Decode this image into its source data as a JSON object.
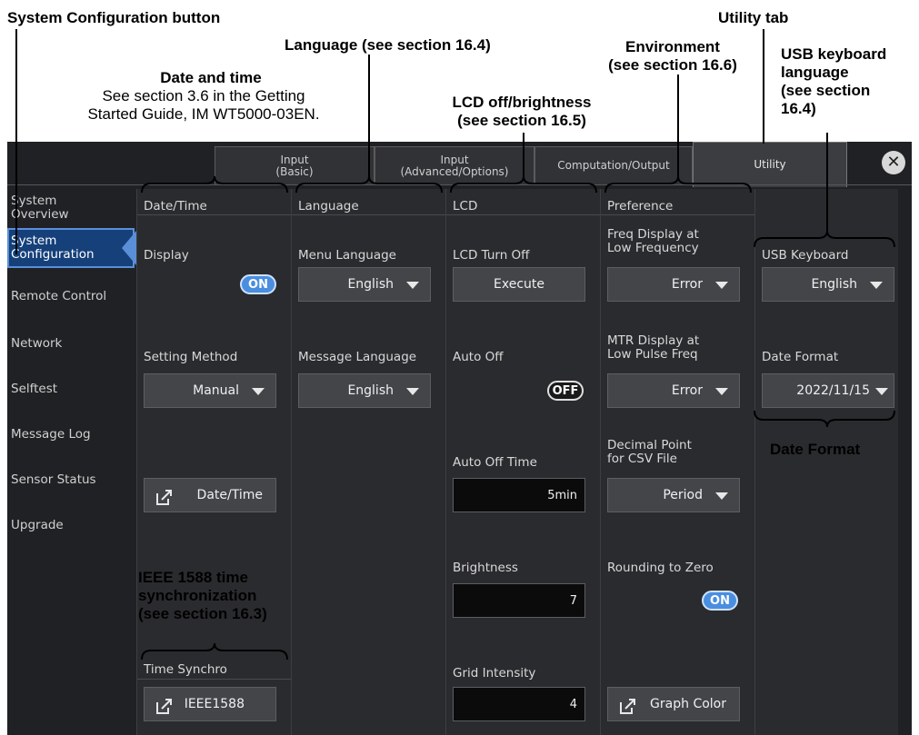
{
  "callouts": {
    "system_configuration_button": "System Configuration button",
    "utility_tab": "Utility tab",
    "language": "Language (see section 16.4)",
    "environment": [
      "Environment",
      "(see section 16.6)"
    ],
    "usb_keyboard_language": [
      "USB keyboard",
      "language",
      "(see section",
      "16.4)"
    ],
    "date_and_time_title": "Date and time",
    "date_and_time_note": [
      "See section 3.6 in the Getting",
      "Started Guide, IM WT5000-03EN."
    ],
    "lcd": [
      "LCD off/brightness",
      "(see section 16.5)"
    ],
    "date_format": "Date Format",
    "ieee1588": [
      "IEEE 1588 time",
      "synchronization",
      "(see section 16.3)"
    ]
  },
  "tabs": [
    {
      "line1": "Input",
      "line2": "(Basic)"
    },
    {
      "line1": "Input",
      "line2": "(Advanced/Options)"
    },
    {
      "line1": "Computation/Output",
      "line2": ""
    },
    {
      "line1": "Utility",
      "line2": ""
    }
  ],
  "sidebar": [
    {
      "line1": "System",
      "line2": "Overview"
    },
    {
      "line1": "System",
      "line2": "Configuration"
    },
    {
      "line1": "Remote Control",
      "line2": ""
    },
    {
      "line1": "Network",
      "line2": ""
    },
    {
      "line1": "Selftest",
      "line2": ""
    },
    {
      "line1": "Message Log",
      "line2": ""
    },
    {
      "line1": "Sensor Status",
      "line2": ""
    },
    {
      "line1": "Upgrade",
      "line2": ""
    }
  ],
  "datetime": {
    "header": "Date/Time",
    "display_label": "Display",
    "display_state": "ON",
    "setting_method_label": "Setting Method",
    "setting_method_value": "Manual",
    "datetime_button": "Date/Time",
    "time_synchro_header": "Time Synchro",
    "ieee_button": "IEEE1588"
  },
  "language": {
    "header": "Language",
    "menu_label": "Menu Language",
    "menu_value": "English",
    "message_label": "Message Language",
    "message_value": "English"
  },
  "lcd": {
    "header": "LCD",
    "turn_off_label": "LCD Turn Off",
    "execute_button": "Execute",
    "auto_off_label": "Auto Off",
    "auto_off_state": "OFF",
    "auto_off_time_label": "Auto Off Time",
    "auto_off_time_value": "5min",
    "brightness_label": "Brightness",
    "brightness_value": "7",
    "grid_label": "Grid Intensity",
    "grid_value": "4"
  },
  "preference": {
    "header": "Preference",
    "freq_label": [
      "Freq Display at",
      "Low Frequency"
    ],
    "freq_value": "Error",
    "mtr_label": [
      "MTR Display at",
      "Low Pulse Freq"
    ],
    "mtr_value": "Error",
    "decimal_label": [
      "Decimal Point",
      "for CSV File"
    ],
    "decimal_value": "Period",
    "rounding_label": "Rounding to Zero",
    "rounding_state": "ON",
    "graph_button": "Graph Color"
  },
  "usb": {
    "keyboard_label": "USB Keyboard",
    "keyboard_value": "English",
    "date_format_label": "Date Format",
    "date_format_value": "2022/11/15"
  },
  "icons": {
    "close": "close-icon",
    "link": "external-link-icon"
  }
}
